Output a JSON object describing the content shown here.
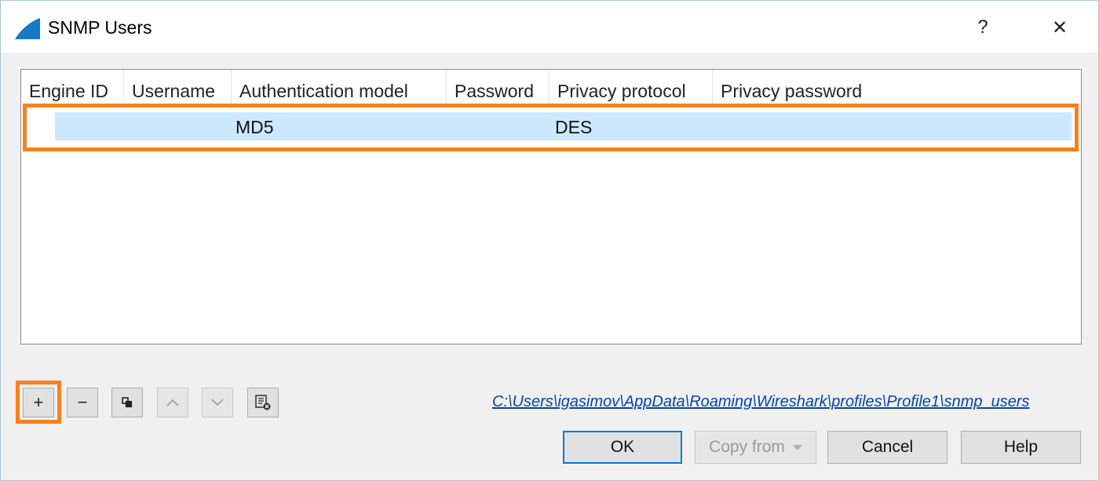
{
  "window": {
    "title": "SNMP Users",
    "help_label": "?",
    "close_label": "✕"
  },
  "table": {
    "columns": [
      "Engine ID",
      "Username",
      "Authentication model",
      "Password",
      "Privacy protocol",
      "Privacy password"
    ],
    "rows": [
      {
        "engine_id": "",
        "username": "",
        "authentication_model": "MD5",
        "password": "",
        "privacy_protocol": "DES",
        "privacy_password": ""
      }
    ]
  },
  "toolbar": {
    "add_label": "+",
    "remove_label": "−",
    "copy_icon": "copy-icon",
    "move_up_icon": "chevron-up-icon",
    "move_down_icon": "chevron-down-icon",
    "clear_icon": "clear-list-icon"
  },
  "file_path": "C:\\Users\\igasimov\\AppData\\Roaming\\Wireshark\\profiles\\Profile1\\snmp_users",
  "buttons": {
    "ok": "OK",
    "copy_from": "Copy from",
    "cancel": "Cancel",
    "help": "Help"
  },
  "colors": {
    "highlight": "#f58220",
    "selection": "#cce8ff",
    "link": "#0645ad"
  }
}
